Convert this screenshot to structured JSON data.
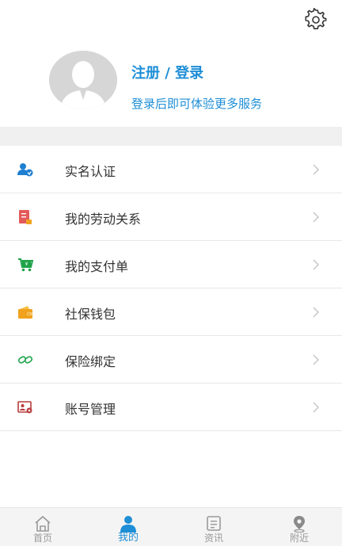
{
  "header": {
    "login_title": "注册 / 登录",
    "login_subtitle": "登录后即可体验更多服务"
  },
  "menu": {
    "items": [
      {
        "label": "实名认证",
        "icon": "user-verify-icon",
        "color": "#1e7fd1"
      },
      {
        "label": "我的劳动关系",
        "icon": "contract-icon",
        "color": "#e35a5a"
      },
      {
        "label": "我的支付单",
        "icon": "payment-cart-icon",
        "color": "#1fa34a"
      },
      {
        "label": "社保钱包",
        "icon": "wallet-icon",
        "color": "#f0a21e"
      },
      {
        "label": "保险绑定",
        "icon": "link-icon",
        "color": "#1fa34a"
      },
      {
        "label": "账号管理",
        "icon": "id-card-icon",
        "color": "#b83b3b"
      }
    ]
  },
  "tabbar": {
    "tabs": [
      {
        "label": "首页",
        "icon": "home-icon",
        "active": false
      },
      {
        "label": "我的",
        "icon": "person-icon",
        "active": true
      },
      {
        "label": "资讯",
        "icon": "news-icon",
        "active": false
      },
      {
        "label": "附近",
        "icon": "location-icon",
        "active": false
      }
    ]
  },
  "colors": {
    "accent": "#1e8ed6",
    "divider": "#f0f0f0",
    "tab_inactive": "#999999"
  }
}
